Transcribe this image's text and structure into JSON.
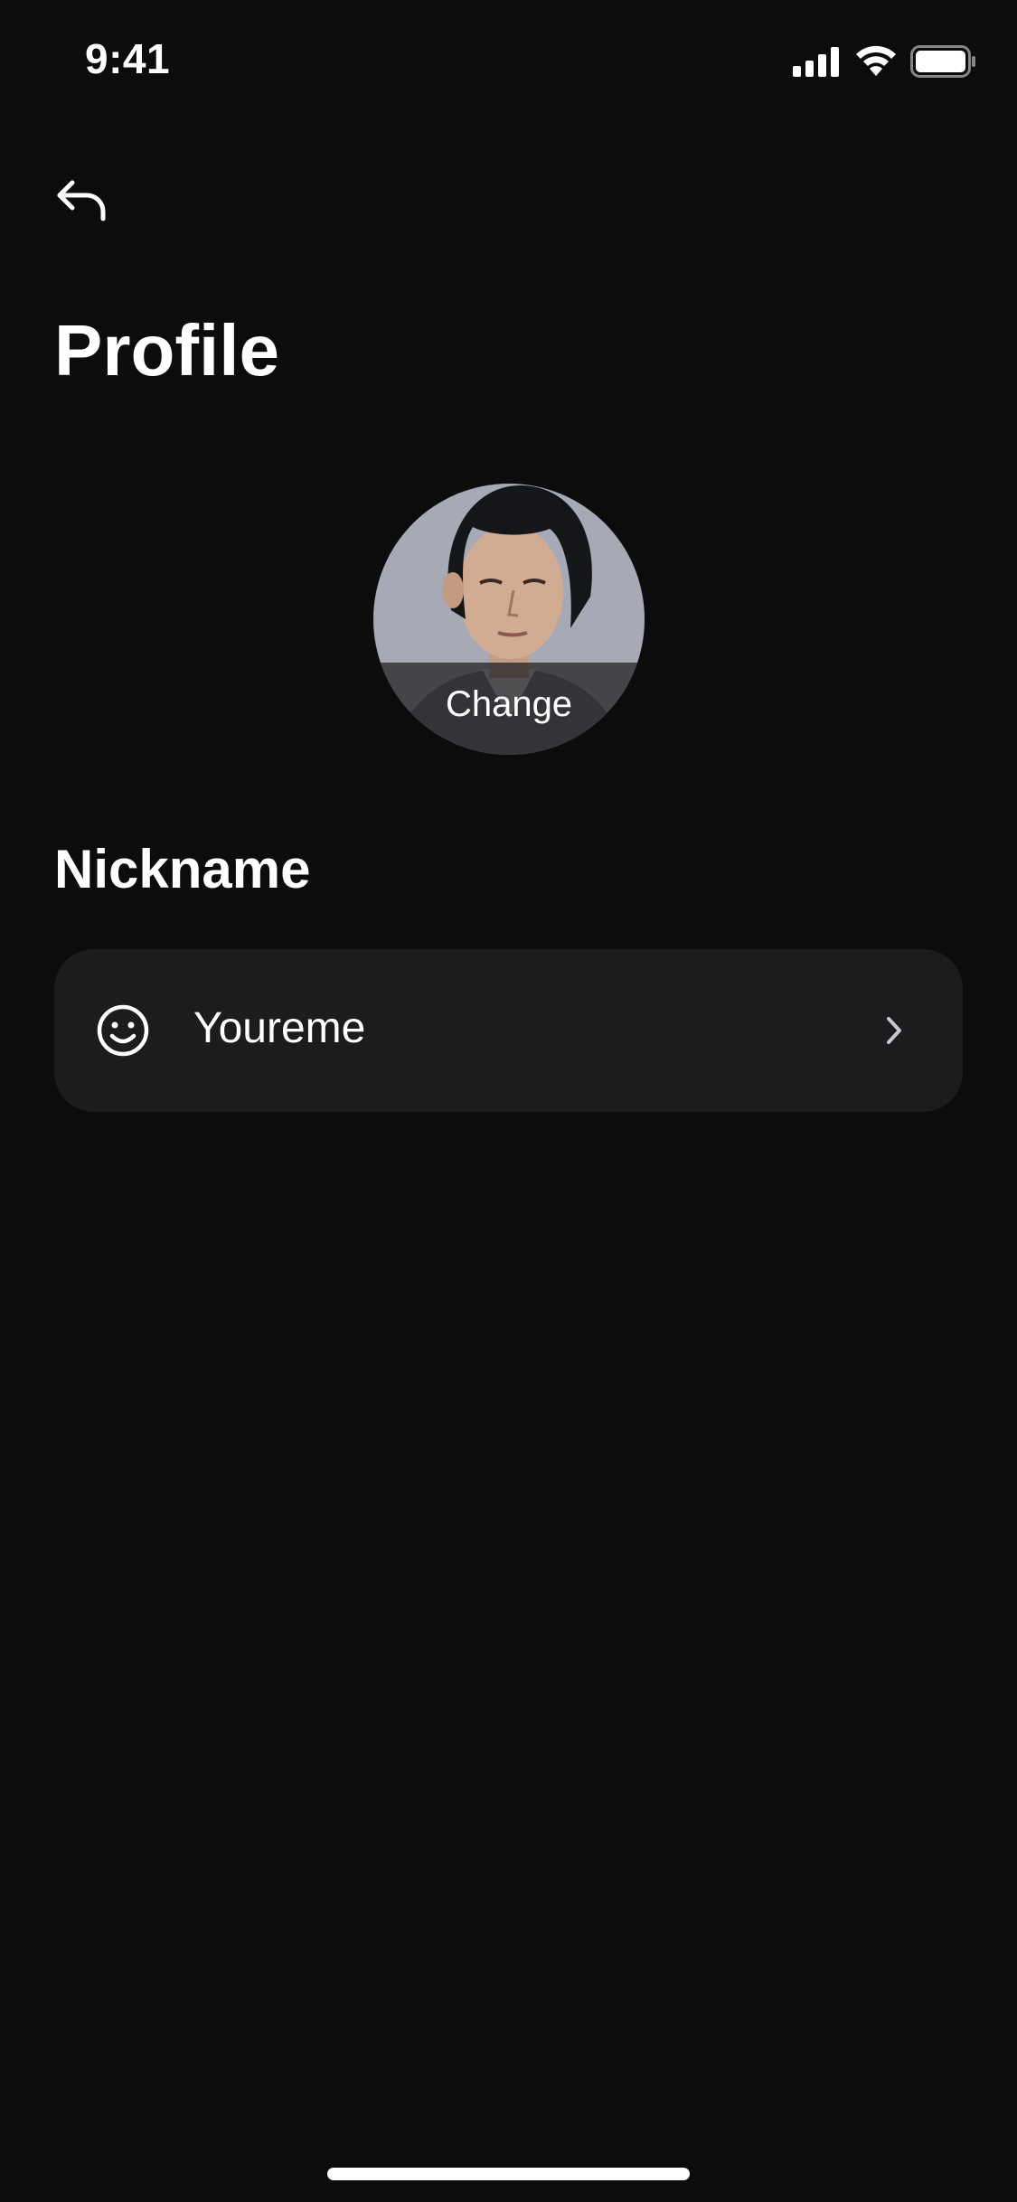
{
  "status_bar": {
    "time": "9:41",
    "icons": [
      "cellular-signal-icon",
      "wifi-icon",
      "battery-icon"
    ]
  },
  "navigation": {
    "back_icon": "back-arrow-icon"
  },
  "page": {
    "title": "Profile"
  },
  "avatar": {
    "change_label": "Change"
  },
  "nickname": {
    "section_title": "Nickname",
    "icon": "smiley-icon",
    "value": "Youreme",
    "chevron_icon": "chevron-right-icon"
  },
  "colors": {
    "background": "#0c0c0c",
    "card": "#1c1c1e",
    "text": "#ffffff"
  }
}
